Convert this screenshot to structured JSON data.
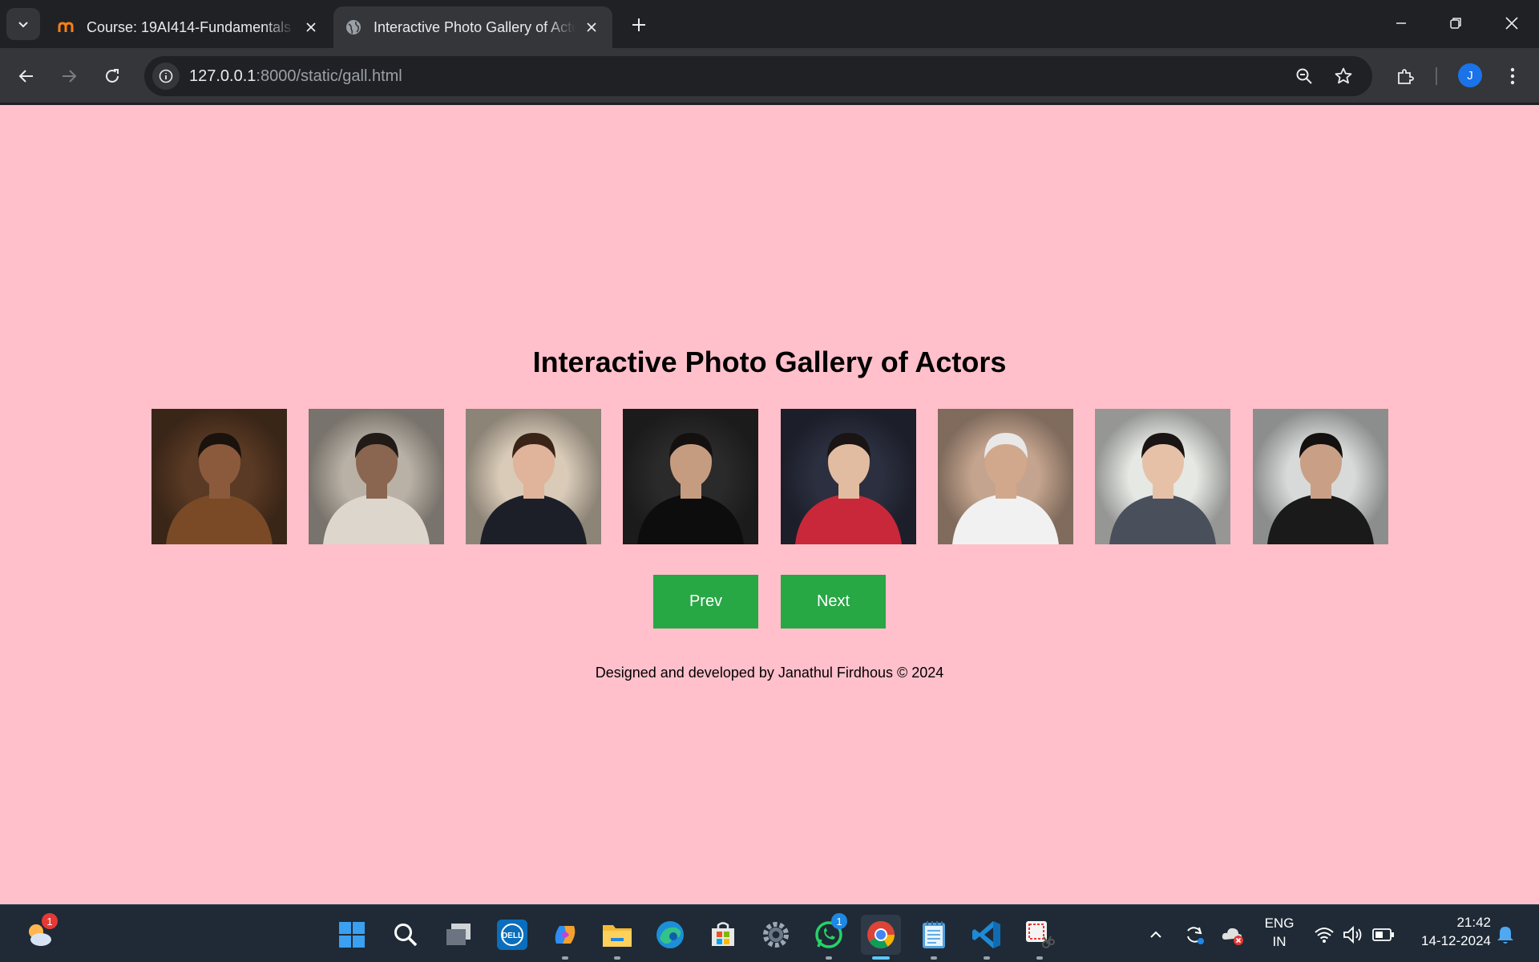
{
  "browser": {
    "tabs": [
      {
        "title": "Course: 19AI414-Fundamentals",
        "favicon": "moodle-icon",
        "active": false
      },
      {
        "title": "Interactive Photo Gallery of Actors",
        "favicon": "globe-icon",
        "active": true
      }
    ],
    "url_host": "127.0.0.1",
    "url_path": ":8000/static/gall.html",
    "profile_initial": "J"
  },
  "page": {
    "heading": "Interactive Photo Gallery of Actors",
    "prev_label": "Prev",
    "next_label": "Next",
    "footer": "Designed and developed by Janathul Firdhous © 2024",
    "photos": [
      {
        "name": "actor-photo-1",
        "bg": "#5a3a24",
        "skin": "#8b5a3c",
        "outfit": "#7a4a26",
        "hair": "#1a120c"
      },
      {
        "name": "actor-photo-2",
        "bg": "#b9b1a6",
        "skin": "#8a6650",
        "outfit": "#dcd6cc",
        "hair": "#221a16"
      },
      {
        "name": "actor-photo-3",
        "bg": "#d9cbb8",
        "skin": "#e0b49a",
        "outfit": "#1d1f28",
        "hair": "#3a2418"
      },
      {
        "name": "actor-photo-4",
        "bg": "#2a2a2a",
        "skin": "#c69c80",
        "outfit": "#0d0d0d",
        "hair": "#151010"
      },
      {
        "name": "actor-photo-5",
        "bg": "#2b2f3f",
        "skin": "#e2bca0",
        "outfit": "#c8283a",
        "hair": "#1a1414"
      },
      {
        "name": "actor-photo-6",
        "bg": "#c4a48e",
        "skin": "#d2a88c",
        "outfit": "#f1f1f1",
        "hair": "#e8e8e8"
      },
      {
        "name": "actor-photo-7",
        "bg": "#e6e8e4",
        "skin": "#e6c1a8",
        "outfit": "#4a4f5c",
        "hair": "#1b1414"
      },
      {
        "name": "actor-photo-8",
        "bg": "#d8dada",
        "skin": "#c9a085",
        "outfit": "#1a1a1a",
        "hair": "#141010"
      }
    ]
  },
  "taskbar": {
    "weather_badge": "1",
    "whatsapp_badge": "1",
    "apps": [
      "start-icon",
      "search-icon",
      "task-view-icon",
      "dell-icon",
      "copilot-icon",
      "file-explorer-icon",
      "edge-icon",
      "store-icon",
      "settings-icon",
      "whatsapp-icon",
      "chrome-icon",
      "notepad-icon",
      "vscode-icon",
      "snipping-tool-icon"
    ],
    "lang_top": "ENG",
    "lang_bottom": "IN",
    "time": "21:42",
    "date": "14-12-2024"
  },
  "colors": {
    "page_bg": "#ffc0cb",
    "button_bg": "#28a745",
    "chrome_dark": "#202124",
    "chrome_toolbar": "#35363a"
  }
}
